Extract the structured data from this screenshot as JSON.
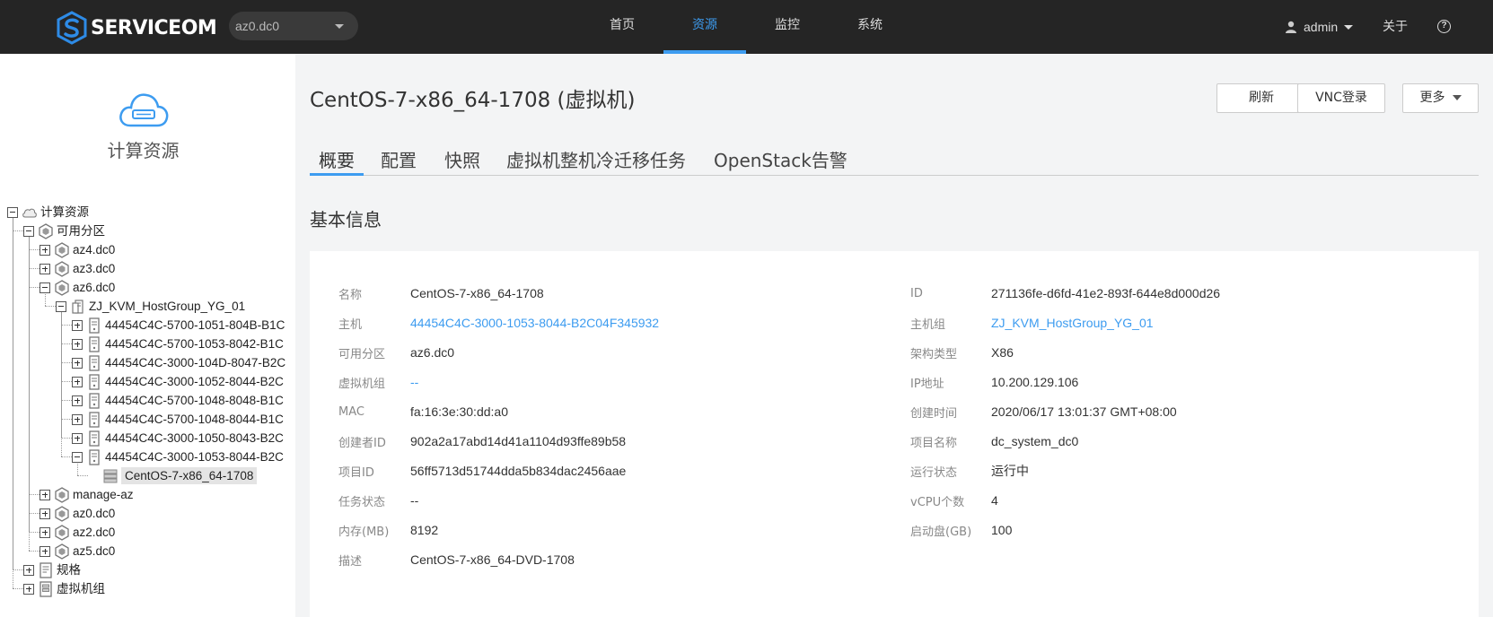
{
  "app": {
    "logo_text": "SERVICEOM",
    "az_selector": "az0.dc0"
  },
  "nav": {
    "items": [
      {
        "label": "首页",
        "active": false
      },
      {
        "label": "资源",
        "active": true
      },
      {
        "label": "监控",
        "active": false
      },
      {
        "label": "系统",
        "active": false
      }
    ],
    "user": "admin",
    "about": "关于",
    "help": "?"
  },
  "sidebar": {
    "title": "计算资源",
    "tree": [
      {
        "label": "计算资源",
        "icon": "cloud-icon",
        "toggle": "minus",
        "level": 0
      },
      {
        "label": "可用分区",
        "icon": "zone-icon",
        "toggle": "minus",
        "level": 1
      },
      {
        "label": "az4.dc0",
        "icon": "zone-icon",
        "toggle": "plus",
        "level": 2
      },
      {
        "label": "az3.dc0",
        "icon": "zone-icon",
        "toggle": "plus",
        "level": 2
      },
      {
        "label": "az6.dc0",
        "icon": "zone-icon",
        "toggle": "minus",
        "level": 2
      },
      {
        "label": "ZJ_KVM_HostGroup_YG_01",
        "icon": "hostgroup-icon",
        "toggle": "minus",
        "level": 3
      },
      {
        "label": "44454C4C-5700-1051-804B-B1C",
        "icon": "host-icon",
        "toggle": "plus",
        "level": 4
      },
      {
        "label": "44454C4C-5700-1053-8042-B1C",
        "icon": "host-icon",
        "toggle": "plus",
        "level": 4
      },
      {
        "label": "44454C4C-3000-104D-8047-B2C",
        "icon": "host-icon",
        "toggle": "plus",
        "level": 4
      },
      {
        "label": "44454C4C-3000-1052-8044-B2C",
        "icon": "host-icon",
        "toggle": "plus",
        "level": 4
      },
      {
        "label": "44454C4C-5700-1048-8048-B1C",
        "icon": "host-icon",
        "toggle": "plus",
        "level": 4
      },
      {
        "label": "44454C4C-5700-1048-8044-B1C",
        "icon": "host-icon",
        "toggle": "plus",
        "level": 4
      },
      {
        "label": "44454C4C-3000-1050-8043-B2C",
        "icon": "host-icon",
        "toggle": "plus",
        "level": 4
      },
      {
        "label": "44454C4C-3000-1053-8044-B2C",
        "icon": "host-icon",
        "toggle": "minus",
        "level": 4
      },
      {
        "label": "CentOS-7-x86_64-1708",
        "icon": "vm-icon",
        "toggle": "none",
        "level": 5,
        "selected": true
      },
      {
        "label": "manage-az",
        "icon": "zone-icon",
        "toggle": "plus",
        "level": 2
      },
      {
        "label": "az0.dc0",
        "icon": "zone-icon",
        "toggle": "plus",
        "level": 2
      },
      {
        "label": "az2.dc0",
        "icon": "zone-icon",
        "toggle": "plus",
        "level": 2
      },
      {
        "label": "az5.dc0",
        "icon": "zone-icon",
        "toggle": "plus",
        "level": 2
      },
      {
        "label": "规格",
        "icon": "flavor-icon",
        "toggle": "plus",
        "level": 1
      },
      {
        "label": "虚拟机组",
        "icon": "vmgroup-icon",
        "toggle": "plus",
        "level": 1
      }
    ]
  },
  "main": {
    "title": "CentOS-7-x86_64-1708 (虚拟机)",
    "buttons": {
      "refresh": "刷新",
      "vnc": "VNC登录",
      "more": "更多"
    },
    "tabs": [
      "概要",
      "配置",
      "快照",
      "虚拟机整机冷迁移任务",
      "OpenStack告警"
    ],
    "active_tab": "概要",
    "section_title": "基本信息",
    "left_fields": [
      {
        "key": "名称",
        "value": "CentOS-7-x86_64-1708",
        "link": false
      },
      {
        "key": "主机",
        "value": "44454C4C-3000-1053-8044-B2C04F345932",
        "link": true
      },
      {
        "key": "可用分区",
        "value": "az6.dc0",
        "link": false
      },
      {
        "key": "虚拟机组",
        "value": "--",
        "link": true
      },
      {
        "key": "MAC",
        "value": "fa:16:3e:30:dd:a0",
        "link": false
      },
      {
        "key": "创建者ID",
        "value": "902a2a17abd14d41a1104d93ffe89b58",
        "link": false
      },
      {
        "key": "项目ID",
        "value": "56ff5713d51744dda5b834dac2456aae",
        "link": false
      },
      {
        "key": "任务状态",
        "value": "--",
        "link": false
      },
      {
        "key": "内存(MB)",
        "value": "8192",
        "link": false
      },
      {
        "key": "描述",
        "value": "CentOS-7-x86_64-DVD-1708",
        "link": false
      }
    ],
    "right_fields": [
      {
        "key": "ID",
        "value": "271136fe-d6fd-41e2-893f-644e8d000d26",
        "link": false
      },
      {
        "key": "主机组",
        "value": "ZJ_KVM_HostGroup_YG_01",
        "link": true
      },
      {
        "key": "架构类型",
        "value": "X86",
        "link": false
      },
      {
        "key": "IP地址",
        "value": "10.200.129.106",
        "link": false
      },
      {
        "key": "创建时间",
        "value": "2020/06/17 13:01:37 GMT+08:00",
        "link": false
      },
      {
        "key": "项目名称",
        "value": "dc_system_dc0",
        "link": false
      },
      {
        "key": "运行状态",
        "value": "运行中",
        "link": false
      },
      {
        "key": "vCPU个数",
        "value": "4",
        "link": false
      },
      {
        "key": "启动盘(GB)",
        "value": "100",
        "link": false
      }
    ]
  }
}
